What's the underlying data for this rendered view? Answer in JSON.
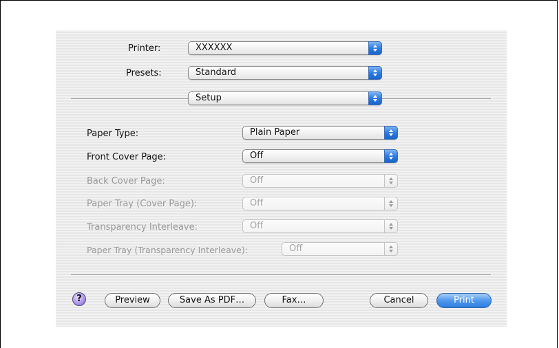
{
  "header": {
    "printer_label": "Printer:",
    "printer_value": "XXXXXX",
    "presets_label": "Presets:",
    "presets_value": "Standard",
    "section_value": "Setup"
  },
  "options": [
    {
      "label": "Paper Type:",
      "value": "Plain Paper",
      "enabled": true
    },
    {
      "label": "Front Cover Page:",
      "value": "Off",
      "enabled": true
    },
    {
      "label": "Back Cover Page:",
      "value": "Off",
      "enabled": false
    },
    {
      "label": "Paper Tray (Cover Page):",
      "value": "Off",
      "enabled": false
    },
    {
      "label": "Transparency Interleave:",
      "value": "Off",
      "enabled": false
    },
    {
      "label": "Paper Tray (Transparency Interleave):",
      "value": "Off",
      "enabled": false
    }
  ],
  "footer": {
    "help_label": "?",
    "preview_label": "Preview",
    "save_pdf_label": "Save As PDF…",
    "fax_label": "Fax…",
    "cancel_label": "Cancel",
    "print_label": "Print"
  }
}
